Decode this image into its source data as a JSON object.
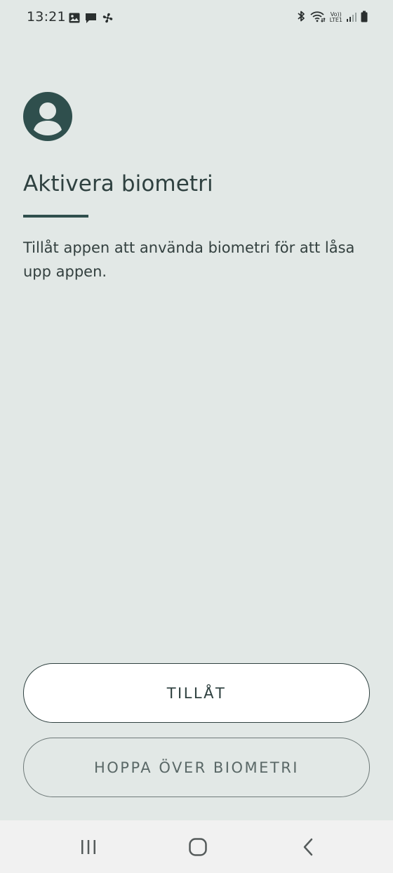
{
  "status_bar": {
    "time": "13:21",
    "left_icons": [
      "gallery-icon",
      "message-icon",
      "fan-icon"
    ],
    "right_icons": [
      "bluetooth-icon",
      "wifi-icon",
      "volte-lte-icon",
      "signal-icon",
      "battery-icon"
    ],
    "network_label_top": "Vo))",
    "network_label_bottom": "LTE1"
  },
  "header": {
    "avatar_icon": "person-icon",
    "title": "Aktivera biometri"
  },
  "main": {
    "description": "Tillåt appen att använda biometri för att låsa upp appen."
  },
  "actions": {
    "allow_label": "TILLÅT",
    "skip_label": "HOPPA ÖVER BIOMETRI"
  },
  "nav_bar": {
    "icons": [
      "recents-icon",
      "home-icon",
      "back-icon"
    ]
  },
  "colors": {
    "background": "#e2e8e6",
    "accent": "#2f4f4d",
    "primary_button_bg": "#ffffff"
  }
}
